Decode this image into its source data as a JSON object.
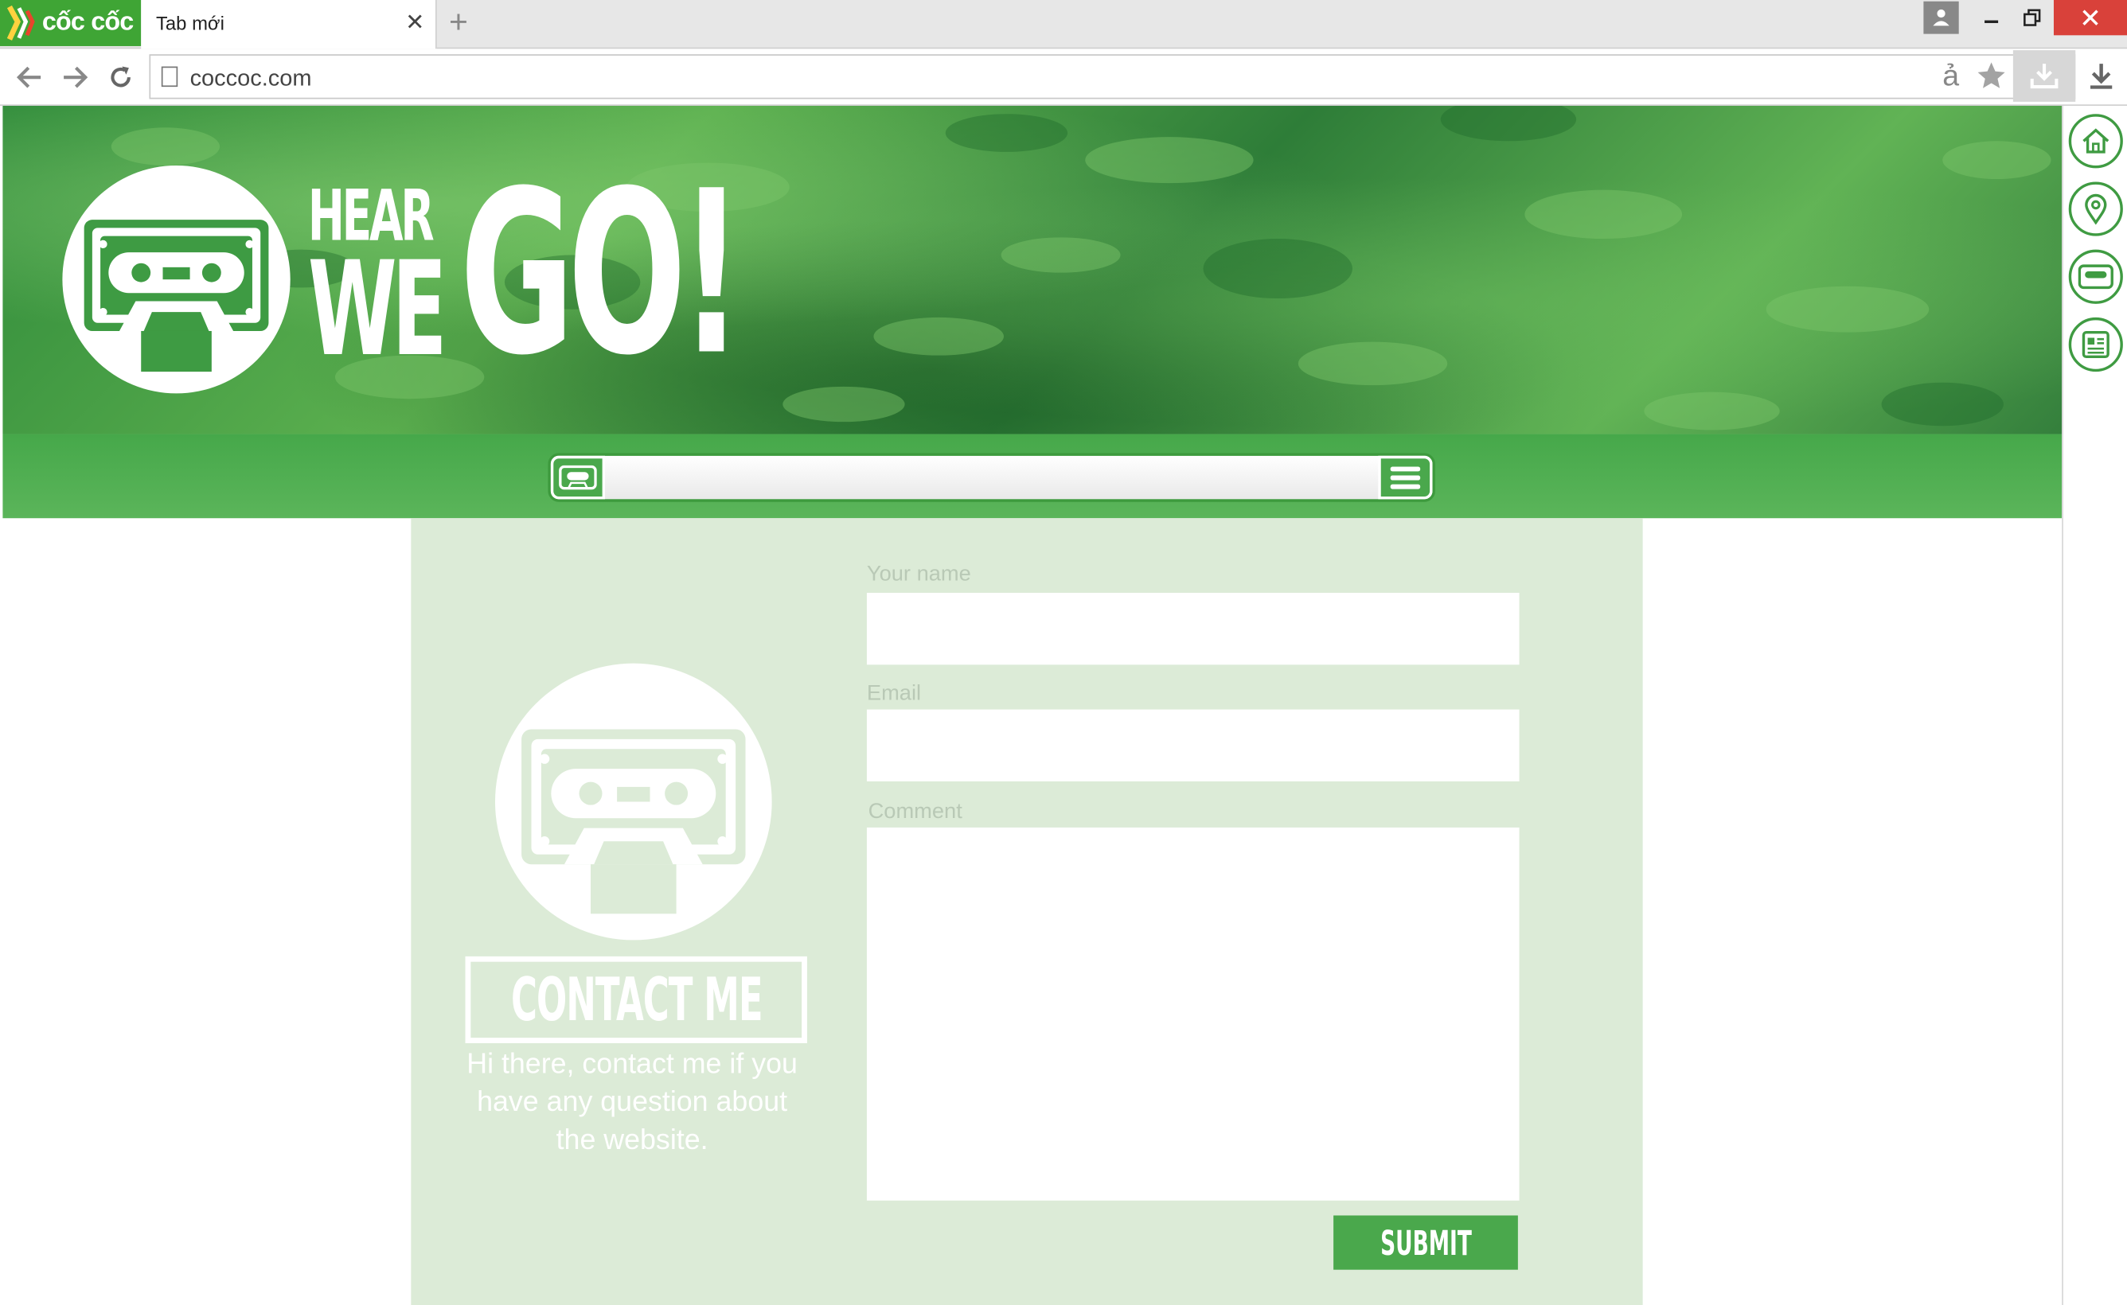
{
  "browser": {
    "brand_name": "cốc cốc",
    "tab_title": "Tab mới",
    "tab_close": "✕",
    "new_tab": "+",
    "url": "coccoc.com",
    "translate_glyph": "ả",
    "accent_color": "#3fa535"
  },
  "site": {
    "logo_text_line1": "HEAR",
    "logo_text_line2": "WE",
    "logo_text_big": "GO!",
    "side_nav": [
      "home-icon",
      "location-pin-icon",
      "cassette-icon",
      "newspaper-icon"
    ],
    "theme_green": "#4aa84c",
    "panel_bg": "#dcebd7"
  },
  "contact": {
    "title": "CONTACT ME",
    "description": "Hi there, contact me if you have any question about the website.",
    "fields": {
      "name_label": "Your name",
      "email_label": "Email",
      "comment_label": "Comment"
    },
    "submit_label": "SUBMIT"
  }
}
